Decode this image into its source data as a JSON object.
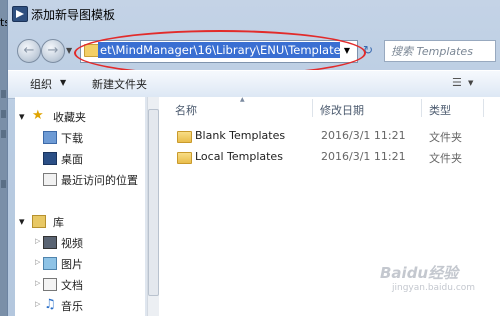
{
  "window": {
    "title": "添加新导图模板",
    "side_mark": "ts"
  },
  "address": {
    "path_text": "et\\MindManager\\16\\Library\\ENU\\Templates"
  },
  "search": {
    "placeholder": "搜索 Templates"
  },
  "toolbar": {
    "organize_label": "组织",
    "new_folder_label": "新建文件夹"
  },
  "nav": {
    "favorites": {
      "label": "收藏夹",
      "items": [
        {
          "label": "下载",
          "icon": "download-folder-icon"
        },
        {
          "label": "桌面",
          "icon": "desktop-icon"
        },
        {
          "label": "最近访问的位置",
          "icon": "recent-places-icon"
        }
      ]
    },
    "libraries": {
      "label": "库",
      "items": [
        {
          "label": "视频",
          "icon": "video-library-icon"
        },
        {
          "label": "图片",
          "icon": "picture-library-icon"
        },
        {
          "label": "文档",
          "icon": "document-library-icon"
        },
        {
          "label": "音乐",
          "icon": "music-library-icon"
        }
      ]
    }
  },
  "columns": {
    "name": "名称",
    "modified": "修改日期",
    "type": "类型"
  },
  "files": [
    {
      "name": "Blank Templates",
      "modified": "2016/3/1 11:21",
      "type": "文件夹"
    },
    {
      "name": "Local Templates",
      "modified": "2016/3/1 11:21",
      "type": "文件夹"
    }
  ],
  "watermark": {
    "brand": "Baidu经验",
    "url": "jingyan.baidu.com"
  },
  "colors": {
    "annotation": "#e22b2b",
    "selection": "#3a6fd2"
  }
}
